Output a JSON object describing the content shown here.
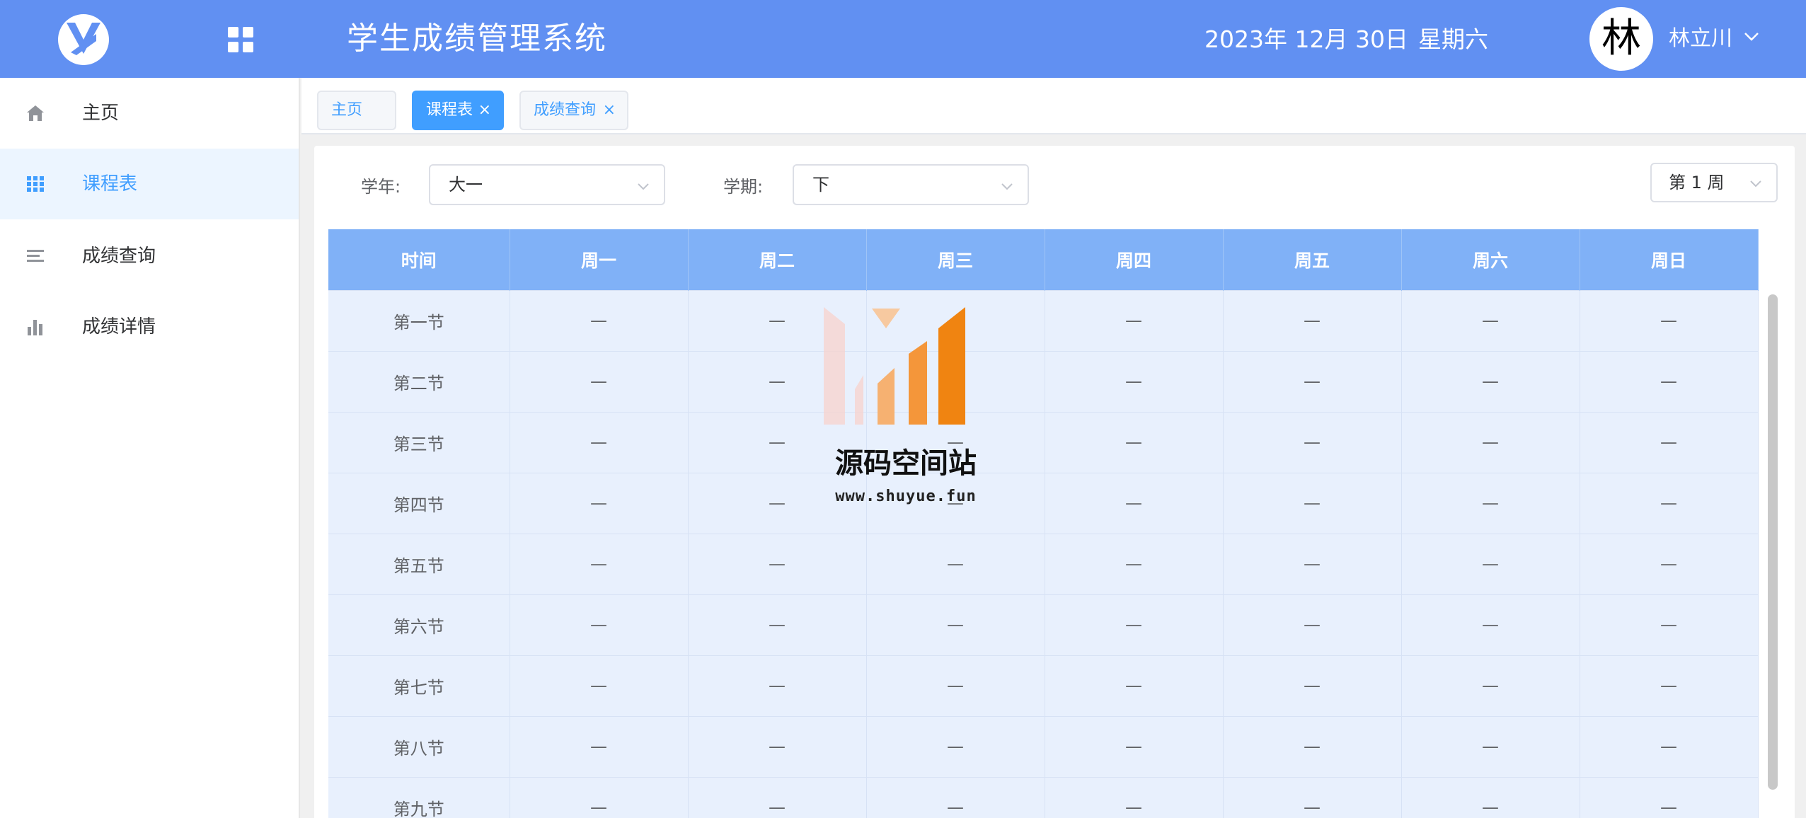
{
  "header": {
    "app_title": "学生成绩管理系统",
    "date": "2023年 12月 30日",
    "weekday": "星期六",
    "user": {
      "avatar_text": "林",
      "name": "林立川"
    }
  },
  "sidebar": {
    "items": [
      {
        "label": "主页",
        "icon": "home-icon",
        "active": false
      },
      {
        "label": "课程表",
        "icon": "grid-icon",
        "active": true
      },
      {
        "label": "成绩查询",
        "icon": "list-icon",
        "active": false
      },
      {
        "label": "成绩详情",
        "icon": "bar-chart-icon",
        "active": false
      }
    ]
  },
  "tabs": [
    {
      "label": "主页",
      "closable": false,
      "active": false
    },
    {
      "label": "课程表",
      "closable": true,
      "active": true,
      "close_glyph": "×"
    },
    {
      "label": "成绩查询",
      "closable": true,
      "active": false,
      "close_glyph": "×"
    }
  ],
  "filters": {
    "year_label": "学年:",
    "year_value": "大一",
    "term_label": "学期:",
    "term_value": "下",
    "week_value": "第 1 周"
  },
  "schedule": {
    "columns": [
      "时间",
      "周一",
      "周二",
      "周三",
      "周四",
      "周五",
      "周六",
      "周日"
    ],
    "rows": [
      {
        "time": "第一节",
        "cells": [
          "—",
          "—",
          "—",
          "—",
          "—",
          "—",
          "—"
        ]
      },
      {
        "time": "第二节",
        "cells": [
          "—",
          "—",
          "—",
          "—",
          "—",
          "—",
          "—"
        ]
      },
      {
        "time": "第三节",
        "cells": [
          "—",
          "—",
          "—",
          "—",
          "—",
          "—",
          "—"
        ]
      },
      {
        "time": "第四节",
        "cells": [
          "—",
          "—",
          "—",
          "—",
          "—",
          "—",
          "—"
        ]
      },
      {
        "time": "第五节",
        "cells": [
          "—",
          "—",
          "—",
          "—",
          "—",
          "—",
          "—"
        ]
      },
      {
        "time": "第六节",
        "cells": [
          "—",
          "—",
          "—",
          "—",
          "—",
          "—",
          "—"
        ]
      },
      {
        "time": "第七节",
        "cells": [
          "—",
          "—",
          "—",
          "—",
          "—",
          "—",
          "—"
        ]
      },
      {
        "time": "第八节",
        "cells": [
          "—",
          "—",
          "—",
          "—",
          "—",
          "—",
          "—"
        ]
      },
      {
        "time": "第九节",
        "cells": [
          "—",
          "—",
          "—",
          "—",
          "—",
          "—",
          "—"
        ]
      }
    ]
  },
  "watermark": {
    "title": "源码空间站",
    "url": "www.shuyue.fun"
  },
  "colors": {
    "header_bg": "#6190f2",
    "accent": "#409eff",
    "table_header": "#80b1f7",
    "table_body": "#e8f0fd"
  }
}
